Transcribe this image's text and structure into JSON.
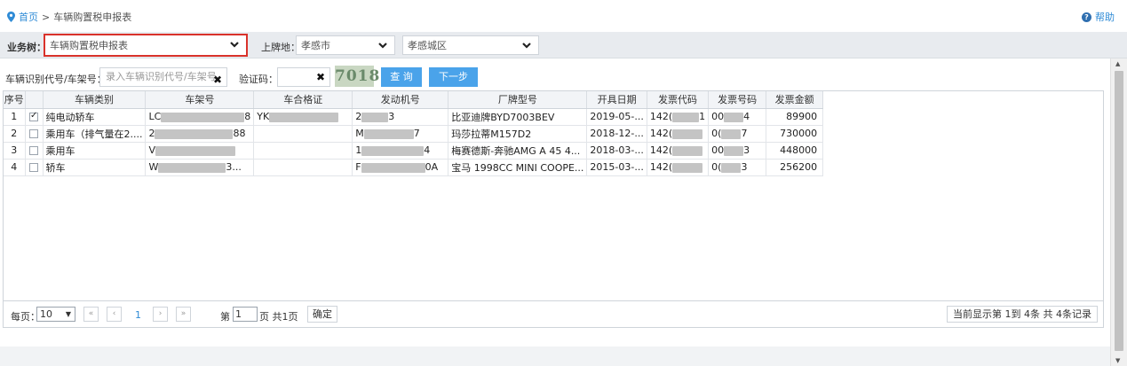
{
  "breadcrumb": {
    "home": "首页",
    "separator": ">",
    "current": "车辆购置税申报表"
  },
  "help": {
    "label": "帮助",
    "icon": "help-circle-icon"
  },
  "business_bar": {
    "label": "业务树：",
    "business_select": "车辆购置税申报表",
    "plate_label": "上牌地：",
    "city_select": "孝感市",
    "district_select": "孝感城区"
  },
  "search": {
    "vin_label": "车辆识别代号/车架号：",
    "vin_placeholder": "录入车辆识别代号/车架号",
    "clear_symbol": "✖",
    "captcha_label": "验证码：",
    "captcha_clear_symbol": "✖",
    "captcha_text": "7018",
    "query_button": "查 询",
    "next_button": "下一步"
  },
  "table": {
    "columns": [
      "序号",
      "",
      "车辆类别",
      "车架号",
      "车合格证",
      "发动机号",
      "厂牌型号",
      "开具日期",
      "发票代码",
      "发票号码",
      "发票金额"
    ],
    "rows": [
      {
        "no": "1",
        "checked": true,
        "category": "纯电动轿车",
        "vin_a": "LC",
        "vin_b": "8",
        "cert_a": "YK",
        "cert_b": "",
        "engine_a": "2",
        "engine_b": "3",
        "model": "比亚迪牌BYD7003BEV",
        "date": "2019-05-...",
        "inv_code_a": "142(",
        "inv_code_b": "1",
        "inv_no_a": "00",
        "inv_no_b": "4",
        "amount": "89900"
      },
      {
        "no": "2",
        "checked": false,
        "category": "乘用车（排气量在2....",
        "vin_a": "2",
        "vin_b": "88",
        "cert_a": "",
        "cert_b": "",
        "engine_a": "M",
        "engine_b": "7",
        "model": "玛莎拉蒂M157D2",
        "date": "2018-12-...",
        "inv_code_a": "142(",
        "inv_code_b": "",
        "inv_no_a": "0(",
        "inv_no_b": "7",
        "amount": "730000"
      },
      {
        "no": "3",
        "checked": false,
        "category": "乘用车",
        "vin_a": "V",
        "vin_b": "",
        "cert_a": "",
        "cert_b": "",
        "engine_a": "1",
        "engine_b": "4",
        "model": "梅赛德斯-奔驰AMG A 45 4...",
        "date": "2018-03-...",
        "inv_code_a": "142(",
        "inv_code_b": "",
        "inv_no_a": "00",
        "inv_no_b": "3",
        "amount": "448000"
      },
      {
        "no": "4",
        "checked": false,
        "category": "轿车",
        "vin_a": "W",
        "vin_b": "3...",
        "cert_a": "",
        "cert_b": "",
        "engine_a": "F",
        "engine_b": "0A",
        "model": "宝马 1998CC MINI COOPE...",
        "date": "2015-03-...",
        "inv_code_a": "142(",
        "inv_code_b": "",
        "inv_no_a": "0(",
        "inv_no_b": "3",
        "amount": "256200"
      }
    ]
  },
  "pager": {
    "per_page_label": "每页：",
    "per_page_value": "10",
    "first": "«",
    "prev": "‹",
    "current": "1",
    "next": "›",
    "last": "»",
    "page_prefix": "第",
    "page_input": "1",
    "page_suffix": "页 共1页",
    "confirm": "确定",
    "info": "当前显示第 1到 4条 共 4条记录"
  }
}
